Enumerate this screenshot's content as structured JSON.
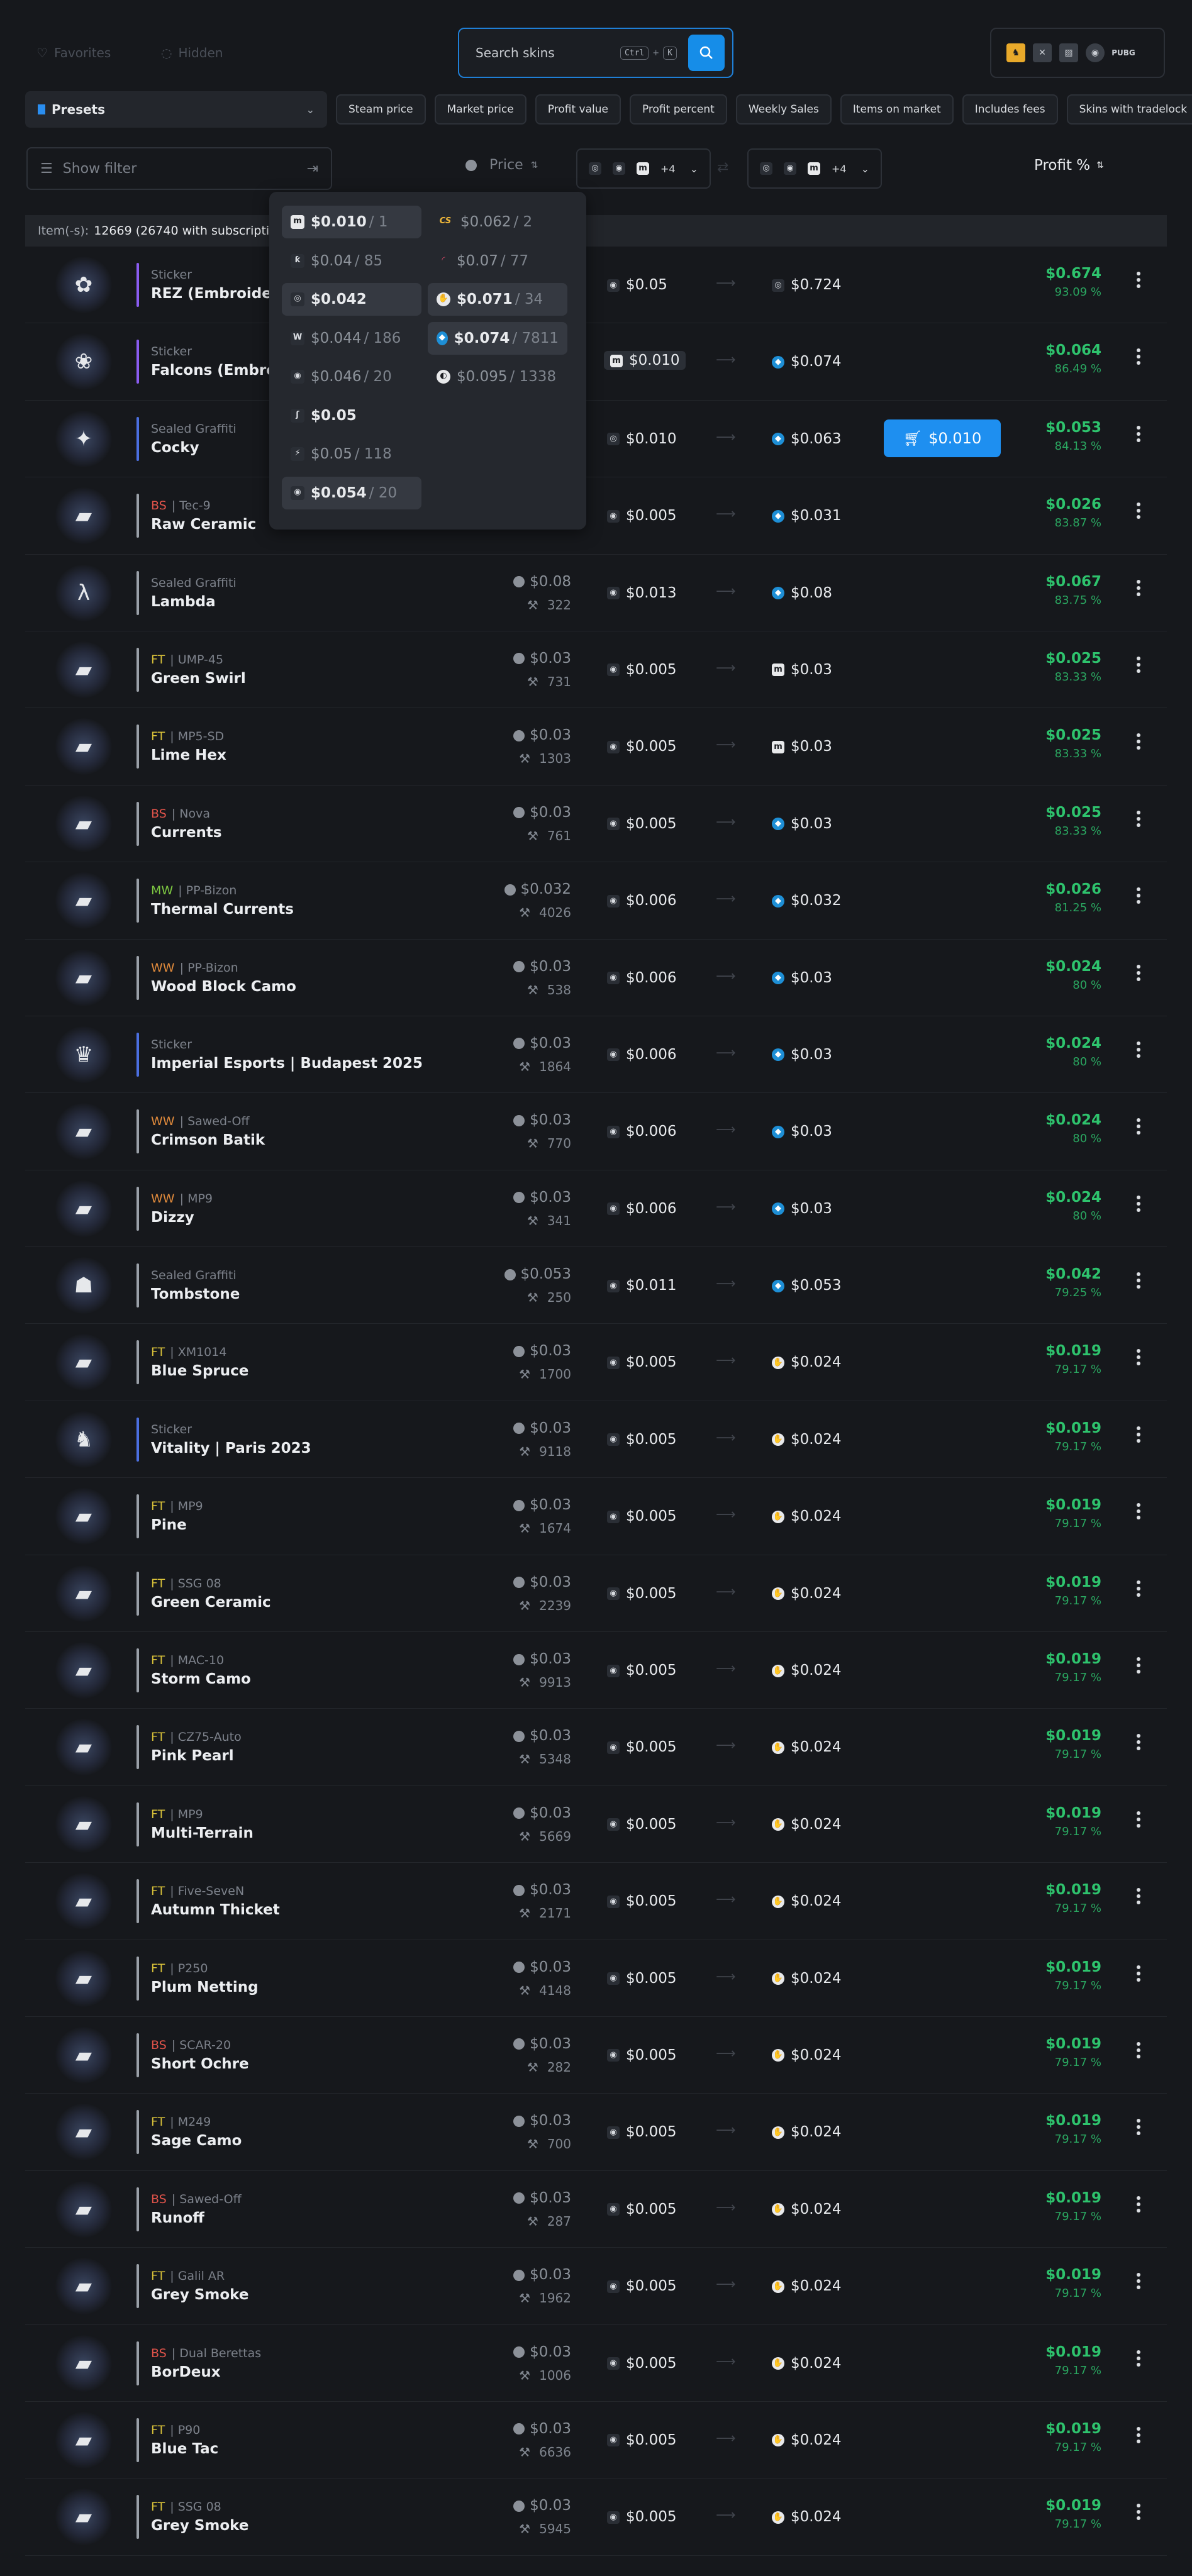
{
  "header": {
    "favorites_label": "Favorites",
    "hidden_label": "Hidden",
    "search_placeholder": "Search skins",
    "shortcut_key1": "Ctrl",
    "shortcut_plus": "+",
    "shortcut_key2": "K",
    "games": [
      "CS2",
      "Dota 2",
      "Rust",
      "TF2",
      "PUBG"
    ]
  },
  "toolbar": {
    "presets_label": "Presets",
    "chips": [
      "Steam price",
      "Market price",
      "Profit value",
      "Profit percent",
      "Weekly Sales",
      "Items on market",
      "Includes fees",
      "Skins with tradelock"
    ]
  },
  "filters": {
    "show_filter": "Show filter",
    "price_label": "Price",
    "sell_market_more": "+4",
    "buy_market_more": "+4",
    "profit_label": "Profit %"
  },
  "count": {
    "label": "Item(-s):",
    "value": "12669 (26740 with subscription)"
  },
  "dropdown": {
    "left": [
      {
        "price": "$0.010",
        "qty": " / 1",
        "market": "m",
        "style": "sel"
      },
      {
        "price": "$0.04",
        "qty": " / 85",
        "market": "l",
        "style": "dim"
      },
      {
        "price": "$0.042",
        "qty": "",
        "market": "c",
        "style": "sel"
      },
      {
        "price": "$0.044",
        "qty": " / 186",
        "market": "w",
        "style": "dim"
      },
      {
        "price": "$0.046",
        "qty": " / 20",
        "market": "b",
        "style": "dim"
      },
      {
        "price": "$0.05",
        "qty": "",
        "market": "s",
        "style": "plain"
      },
      {
        "price": "$0.05",
        "qty": " / 118",
        "market": "z",
        "style": "dim"
      },
      {
        "price": "$0.054",
        "qty": " / 20",
        "market": "b",
        "style": "sel"
      }
    ],
    "right": [
      {
        "price": "$0.062",
        "qty": " / 2",
        "market": "cs",
        "style": "dim"
      },
      {
        "price": "$0.07",
        "qty": " / 77",
        "market": "r",
        "style": "dim"
      },
      {
        "price": "$0.071",
        "qty": " / 34",
        "market": "h",
        "style": "sel"
      },
      {
        "price": "$0.074",
        "qty": " / 7811",
        "market": "k",
        "style": "sel"
      },
      {
        "price": "$0.095",
        "qty": " / 1338",
        "market": "o",
        "style": "dim"
      }
    ]
  },
  "buy_button_price": "$0.010",
  "rows": [
    {
      "type": "Sticker",
      "wear": "",
      "name": "REZ (Embroidered) | Copenhagen 2024",
      "price": "",
      "volume": "",
      "sell": "$0.05",
      "buy": "$0.724",
      "profit": "$0.674",
      "pct": "93.09 %",
      "bar": "#8a5cf0",
      "thumb": "✿",
      "sm": "b",
      "bm": "c"
    },
    {
      "type": "Sticker",
      "wear": "",
      "name": "Falcons (Embroidered) | Copenhagen 2024",
      "price": "",
      "volume": "",
      "sell": "$0.010",
      "buy": "$0.074",
      "profit": "$0.064",
      "pct": "86.49 %",
      "bar": "#8a5cf0",
      "thumb": "❀",
      "sm": "m",
      "bm": "k",
      "hl": true
    },
    {
      "type": "Sealed Graffiti",
      "wear": "",
      "name": "Cocky",
      "price": "",
      "volume": "",
      "sell": "$0.010",
      "buy": "$0.063",
      "profit": "$0.053",
      "pct": "84.13 %",
      "bar": "#4b6fe0",
      "thumb": "✦",
      "sm": "c",
      "bm": "k",
      "btn": true
    },
    {
      "type": "Tec-9",
      "wear": "BS",
      "name": "Raw Ceramic",
      "price": "",
      "volume": "",
      "sell": "$0.005",
      "buy": "$0.031",
      "profit": "$0.026",
      "pct": "83.87 %",
      "bar": "#9aa0a8",
      "thumb": "▰",
      "sm": "b",
      "bm": "k"
    },
    {
      "type": "Sealed Graffiti",
      "wear": "",
      "name": "Lambda",
      "price": "$0.08",
      "volume": "322",
      "sell": "$0.013",
      "buy": "$0.08",
      "profit": "$0.067",
      "pct": "83.75 %",
      "bar": "#9aa0a8",
      "thumb": "λ",
      "sm": "b",
      "bm": "k"
    },
    {
      "type": "UMP-45",
      "wear": "FT",
      "name": "Green Swirl",
      "price": "$0.03",
      "volume": "731",
      "sell": "$0.005",
      "buy": "$0.03",
      "profit": "$0.025",
      "pct": "83.33 %",
      "bar": "#9aa0a8",
      "thumb": "▰",
      "sm": "b",
      "bm": "m"
    },
    {
      "type": "MP5-SD",
      "wear": "FT",
      "name": "Lime Hex",
      "price": "$0.03",
      "volume": "1303",
      "sell": "$0.005",
      "buy": "$0.03",
      "profit": "$0.025",
      "pct": "83.33 %",
      "bar": "#9aa0a8",
      "thumb": "▰",
      "sm": "b",
      "bm": "m"
    },
    {
      "type": "Nova",
      "wear": "BS",
      "name": "Currents",
      "price": "$0.03",
      "volume": "761",
      "sell": "$0.005",
      "buy": "$0.03",
      "profit": "$0.025",
      "pct": "83.33 %",
      "bar": "#9aa0a8",
      "thumb": "▰",
      "sm": "b",
      "bm": "k"
    },
    {
      "type": "PP-Bizon",
      "wear": "MW",
      "name": "Thermal Currents",
      "price": "$0.032",
      "volume": "4026",
      "sell": "$0.006",
      "buy": "$0.032",
      "profit": "$0.026",
      "pct": "81.25 %",
      "bar": "#9aa0a8",
      "thumb": "▰",
      "sm": "b",
      "bm": "k"
    },
    {
      "type": "PP-Bizon",
      "wear": "WW",
      "name": "Wood Block Camo",
      "price": "$0.03",
      "volume": "538",
      "sell": "$0.006",
      "buy": "$0.03",
      "profit": "$0.024",
      "pct": "80 %",
      "bar": "#9aa0a8",
      "thumb": "▰",
      "sm": "b",
      "bm": "k"
    },
    {
      "type": "Sticker",
      "wear": "",
      "name": "Imperial Esports | Budapest 2025",
      "price": "$0.03",
      "volume": "1864",
      "sell": "$0.006",
      "buy": "$0.03",
      "profit": "$0.024",
      "pct": "80 %",
      "bar": "#4b6fe0",
      "thumb": "♛",
      "sm": "b",
      "bm": "k"
    },
    {
      "type": "Sawed-Off",
      "wear": "WW",
      "name": "Crimson Batik",
      "price": "$0.03",
      "volume": "770",
      "sell": "$0.006",
      "buy": "$0.03",
      "profit": "$0.024",
      "pct": "80 %",
      "bar": "#9aa0a8",
      "thumb": "▰",
      "sm": "b",
      "bm": "k"
    },
    {
      "type": "MP9",
      "wear": "WW",
      "name": "Dizzy",
      "price": "$0.03",
      "volume": "341",
      "sell": "$0.006",
      "buy": "$0.03",
      "profit": "$0.024",
      "pct": "80 %",
      "bar": "#9aa0a8",
      "thumb": "▰",
      "sm": "b",
      "bm": "k"
    },
    {
      "type": "Sealed Graffiti",
      "wear": "",
      "name": "Tombstone",
      "price": "$0.053",
      "volume": "250",
      "sell": "$0.011",
      "buy": "$0.053",
      "profit": "$0.042",
      "pct": "79.25 %",
      "bar": "#9aa0a8",
      "thumb": "☗",
      "sm": "b",
      "bm": "k"
    },
    {
      "type": "XM1014",
      "wear": "FT",
      "name": "Blue Spruce",
      "price": "$0.03",
      "volume": "1700",
      "sell": "$0.005",
      "buy": "$0.024",
      "profit": "$0.019",
      "pct": "79.17 %",
      "bar": "#9aa0a8",
      "thumb": "▰",
      "sm": "b",
      "bm": "h"
    },
    {
      "type": "Sticker",
      "wear": "",
      "name": "Vitality | Paris 2023",
      "price": "$0.03",
      "volume": "9118",
      "sell": "$0.005",
      "buy": "$0.024",
      "profit": "$0.019",
      "pct": "79.17 %",
      "bar": "#4b6fe0",
      "thumb": "♞",
      "sm": "b",
      "bm": "h"
    },
    {
      "type": "MP9",
      "wear": "FT",
      "name": "Pine",
      "price": "$0.03",
      "volume": "1674",
      "sell": "$0.005",
      "buy": "$0.024",
      "profit": "$0.019",
      "pct": "79.17 %",
      "bar": "#9aa0a8",
      "thumb": "▰",
      "sm": "b",
      "bm": "h"
    },
    {
      "type": "SSG 08",
      "wear": "FT",
      "name": "Green Ceramic",
      "price": "$0.03",
      "volume": "2239",
      "sell": "$0.005",
      "buy": "$0.024",
      "profit": "$0.019",
      "pct": "79.17 %",
      "bar": "#9aa0a8",
      "thumb": "▰",
      "sm": "b",
      "bm": "h"
    },
    {
      "type": "MAC-10",
      "wear": "FT",
      "name": "Storm Camo",
      "price": "$0.03",
      "volume": "9913",
      "sell": "$0.005",
      "buy": "$0.024",
      "profit": "$0.019",
      "pct": "79.17 %",
      "bar": "#9aa0a8",
      "thumb": "▰",
      "sm": "b",
      "bm": "h"
    },
    {
      "type": "CZ75-Auto",
      "wear": "FT",
      "name": "Pink Pearl",
      "price": "$0.03",
      "volume": "5348",
      "sell": "$0.005",
      "buy": "$0.024",
      "profit": "$0.019",
      "pct": "79.17 %",
      "bar": "#9aa0a8",
      "thumb": "▰",
      "sm": "b",
      "bm": "h"
    },
    {
      "type": "MP9",
      "wear": "FT",
      "name": "Multi-Terrain",
      "price": "$0.03",
      "volume": "5669",
      "sell": "$0.005",
      "buy": "$0.024",
      "profit": "$0.019",
      "pct": "79.17 %",
      "bar": "#9aa0a8",
      "thumb": "▰",
      "sm": "b",
      "bm": "h"
    },
    {
      "type": "Five-SeveN",
      "wear": "FT",
      "name": "Autumn Thicket",
      "price": "$0.03",
      "volume": "2171",
      "sell": "$0.005",
      "buy": "$0.024",
      "profit": "$0.019",
      "pct": "79.17 %",
      "bar": "#9aa0a8",
      "thumb": "▰",
      "sm": "b",
      "bm": "h"
    },
    {
      "type": "P250",
      "wear": "FT",
      "name": "Plum Netting",
      "price": "$0.03",
      "volume": "4148",
      "sell": "$0.005",
      "buy": "$0.024",
      "profit": "$0.019",
      "pct": "79.17 %",
      "bar": "#9aa0a8",
      "thumb": "▰",
      "sm": "b",
      "bm": "h"
    },
    {
      "type": "SCAR-20",
      "wear": "BS",
      "name": "Short Ochre",
      "price": "$0.03",
      "volume": "282",
      "sell": "$0.005",
      "buy": "$0.024",
      "profit": "$0.019",
      "pct": "79.17 %",
      "bar": "#9aa0a8",
      "thumb": "▰",
      "sm": "b",
      "bm": "h"
    },
    {
      "type": "M249",
      "wear": "FT",
      "name": "Sage Camo",
      "price": "$0.03",
      "volume": "700",
      "sell": "$0.005",
      "buy": "$0.024",
      "profit": "$0.019",
      "pct": "79.17 %",
      "bar": "#9aa0a8",
      "thumb": "▰",
      "sm": "b",
      "bm": "h"
    },
    {
      "type": "Sawed-Off",
      "wear": "BS",
      "name": "Runoff",
      "price": "$0.03",
      "volume": "287",
      "sell": "$0.005",
      "buy": "$0.024",
      "profit": "$0.019",
      "pct": "79.17 %",
      "bar": "#9aa0a8",
      "thumb": "▰",
      "sm": "b",
      "bm": "h"
    },
    {
      "type": "Galil AR",
      "wear": "FT",
      "name": "Grey Smoke",
      "price": "$0.03",
      "volume": "1962",
      "sell": "$0.005",
      "buy": "$0.024",
      "profit": "$0.019",
      "pct": "79.17 %",
      "bar": "#9aa0a8",
      "thumb": "▰",
      "sm": "b",
      "bm": "h"
    },
    {
      "type": "Dual Berettas",
      "wear": "BS",
      "name": "BorDeux",
      "price": "$0.03",
      "volume": "1006",
      "sell": "$0.005",
      "buy": "$0.024",
      "profit": "$0.019",
      "pct": "79.17 %",
      "bar": "#9aa0a8",
      "thumb": "▰",
      "sm": "b",
      "bm": "h"
    },
    {
      "type": "P90",
      "wear": "FT",
      "name": "Blue Tac",
      "price": "$0.03",
      "volume": "6636",
      "sell": "$0.005",
      "buy": "$0.024",
      "profit": "$0.019",
      "pct": "79.17 %",
      "bar": "#9aa0a8",
      "thumb": "▰",
      "sm": "b",
      "bm": "h"
    },
    {
      "type": "SSG 08",
      "wear": "FT",
      "name": "Grey Smoke",
      "price": "$0.03",
      "volume": "5945",
      "sell": "$0.005",
      "buy": "$0.024",
      "profit": "$0.019",
      "pct": "79.17 %",
      "bar": "#9aa0a8",
      "thumb": "▰",
      "sm": "b",
      "bm": "h"
    }
  ],
  "colors": {
    "accent": "#168de8",
    "profit": "#2ec36d",
    "BS": "#e0534a",
    "FT": "#d8c13a",
    "MW": "#7ec942",
    "WW": "#e08a3c",
    "FN": "#3fbf6a"
  }
}
